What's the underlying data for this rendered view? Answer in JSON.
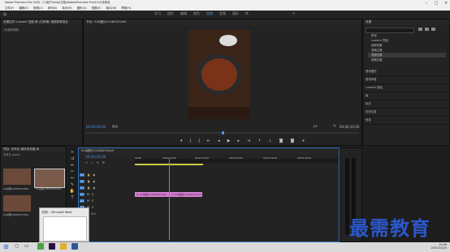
{
  "titlebar": {
    "app_title": "Adobe Premiere Pro 2020 - C:\\用户\\shiqi\\文档\\Adobe\\Premiere Pro\\14.0\\未命名",
    "menus": [
      "文件(F)",
      "编辑(E)",
      "剪辑(C)",
      "序列(S)",
      "标记(M)",
      "图形(G)",
      "视图(V)",
      "窗口(W)",
      "帮助(H)"
    ]
  },
  "workspace": {
    "tabs": [
      "学习",
      "组件",
      "编辑",
      "颜色",
      "效果",
      "音频",
      "图形",
      "库"
    ],
    "active": "效果"
  },
  "left_panel": {
    "title": "效果控件  Lumetri 范围  源:(无剪辑)  音频剪辑混合",
    "subtitle": "(未选择剪辑)"
  },
  "program_monitor": {
    "title": "节目: 01动图片0108Gf1h5a9",
    "timecode_left": "00;00;00;00",
    "fit": "适合",
    "quality": "1/2",
    "timecode_right": "00;00;10;00"
  },
  "effects_panel": {
    "title": "效果",
    "tree": [
      "预设",
      "Lumetri 预设",
      "音频效果",
      "音频过渡",
      "视频效果",
      "视频过渡"
    ],
    "sections": [
      "基本图形",
      "基本声音",
      "Lumetri 颜色",
      "库",
      "标记",
      "历史记录",
      "信息"
    ]
  },
  "project_panel": {
    "title": "项目: 未命名  媒体浏览器  库",
    "path": "未命名.prproj",
    "items": [
      {
        "name": "01动图片0108Gf1h5a9",
        "duration": "5;00"
      },
      {
        "name": "01动图片0108Gf1h5a9",
        "duration": "5;00"
      },
      {
        "name": "01动图片0108Gf1h5a9",
        "duration": "5;00"
      }
    ]
  },
  "timeline": {
    "title": "01动图片0108Gf1h5a9",
    "timecode": "00;00;05;00",
    "ruler": [
      "00;00",
      "00;00;05;00",
      "00;00;10;00",
      "00;00;15;00",
      "00;00;20;00",
      "00;00;25;00"
    ],
    "tracks": [
      "V3",
      "V2",
      "V1",
      "A1",
      "A2",
      "A3"
    ],
    "master": "主声道",
    "master_value": "0.0",
    "clips": [
      "fx 01动图片0108Gf1h5a9",
      "fx 01动图片0108Gf1h5a9"
    ]
  },
  "popup": {
    "title": "文档1 - Microsoft Word"
  },
  "watermark": "最需教育",
  "taskbar": {
    "time": "15:46",
    "date": "2021/10/24"
  }
}
